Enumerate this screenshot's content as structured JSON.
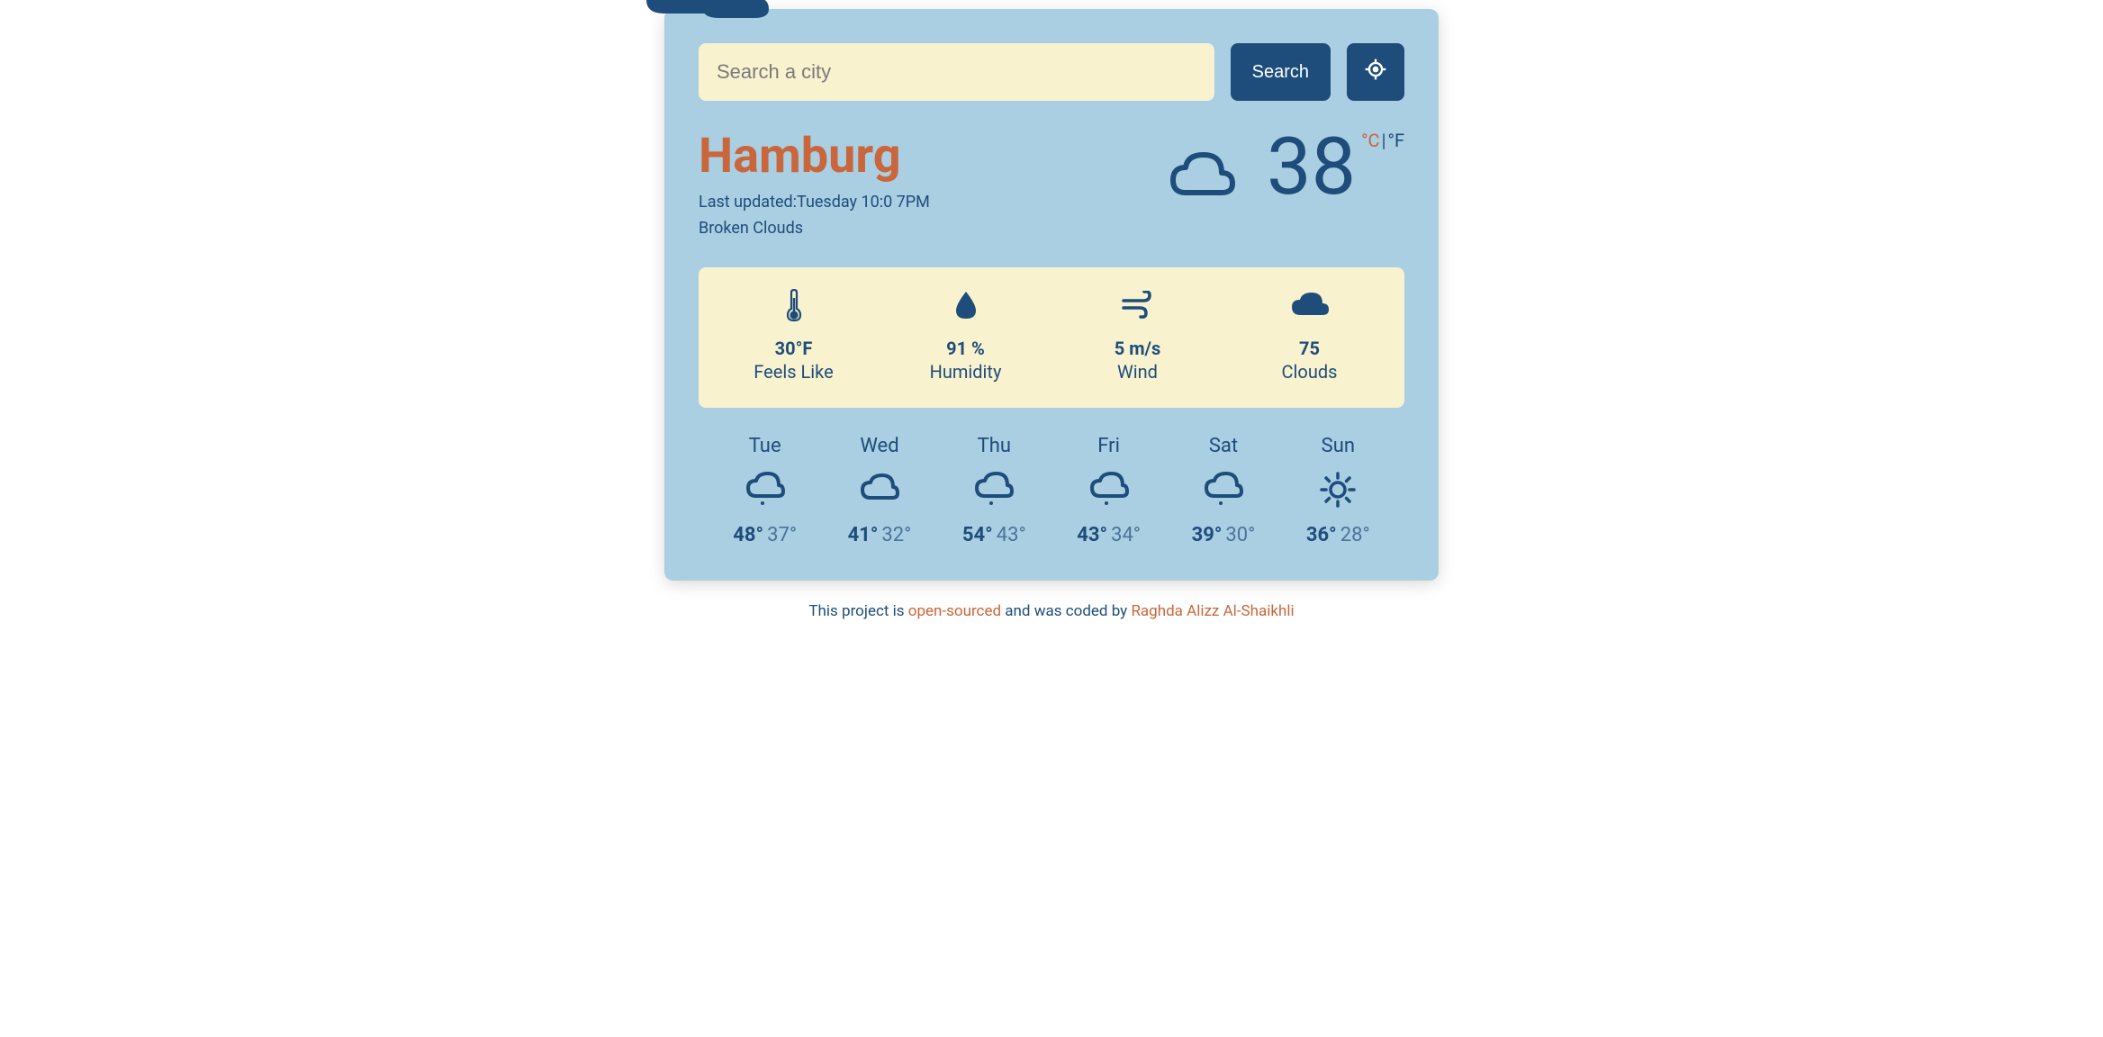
{
  "search": {
    "placeholder": "Search a city",
    "button_label": "Search"
  },
  "current": {
    "city": "Hamburg",
    "last_updated_label": "Last updated:",
    "last_updated_value": "Tuesday 10:0 7PM",
    "condition": "Broken Clouds",
    "temp": "38",
    "unit_c": "°C",
    "unit_sep": "|",
    "unit_f": "°F"
  },
  "stats": {
    "feels_like": {
      "value": "30°F",
      "label": "Feels Like"
    },
    "humidity": {
      "value": "91 %",
      "label": "Humidity"
    },
    "wind": {
      "value": "5 m/s",
      "label": "Wind"
    },
    "clouds": {
      "value": "75",
      "label": "Clouds"
    }
  },
  "forecast": [
    {
      "day": "Tue",
      "icon": "cloud-drizzle",
      "max": "48°",
      "min": "37°"
    },
    {
      "day": "Wed",
      "icon": "cloud",
      "max": "41°",
      "min": "32°"
    },
    {
      "day": "Thu",
      "icon": "cloud-drizzle",
      "max": "54°",
      "min": "43°"
    },
    {
      "day": "Fri",
      "icon": "cloud-drizzle",
      "max": "43°",
      "min": "34°"
    },
    {
      "day": "Sat",
      "icon": "cloud-drizzle",
      "max": "39°",
      "min": "30°"
    },
    {
      "day": "Sun",
      "icon": "sunny",
      "max": "36°",
      "min": "28°"
    }
  ],
  "footer": {
    "text1": "This project is ",
    "link1": "open-sourced",
    "text2": " and was coded by ",
    "link2": "Raghda Alizz Al-Shaikhli"
  }
}
